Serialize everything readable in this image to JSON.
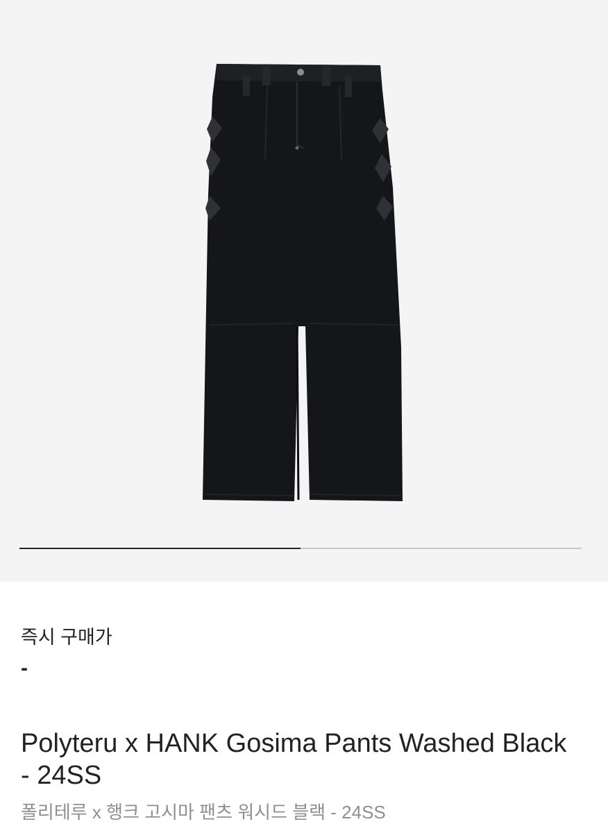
{
  "gallery": {
    "image_alt": "Polyteru x HANK Gosima Pants Washed Black - 24SS",
    "progress": 0.5
  },
  "purchase": {
    "label": "즉시 구매가",
    "value": "-"
  },
  "product": {
    "title": "Polyteru x HANK Gosima Pants Washed Black - 24SS",
    "subtitle": "폴리테루 x 행크 고시마 팬츠 워시드 블랙 - 24SS"
  },
  "colors": {
    "gallery_bg": "#f4f4f4",
    "progress_active": "#222222",
    "progress_track": "#c9c9c9",
    "subtitle_text": "#8f8f8f"
  }
}
